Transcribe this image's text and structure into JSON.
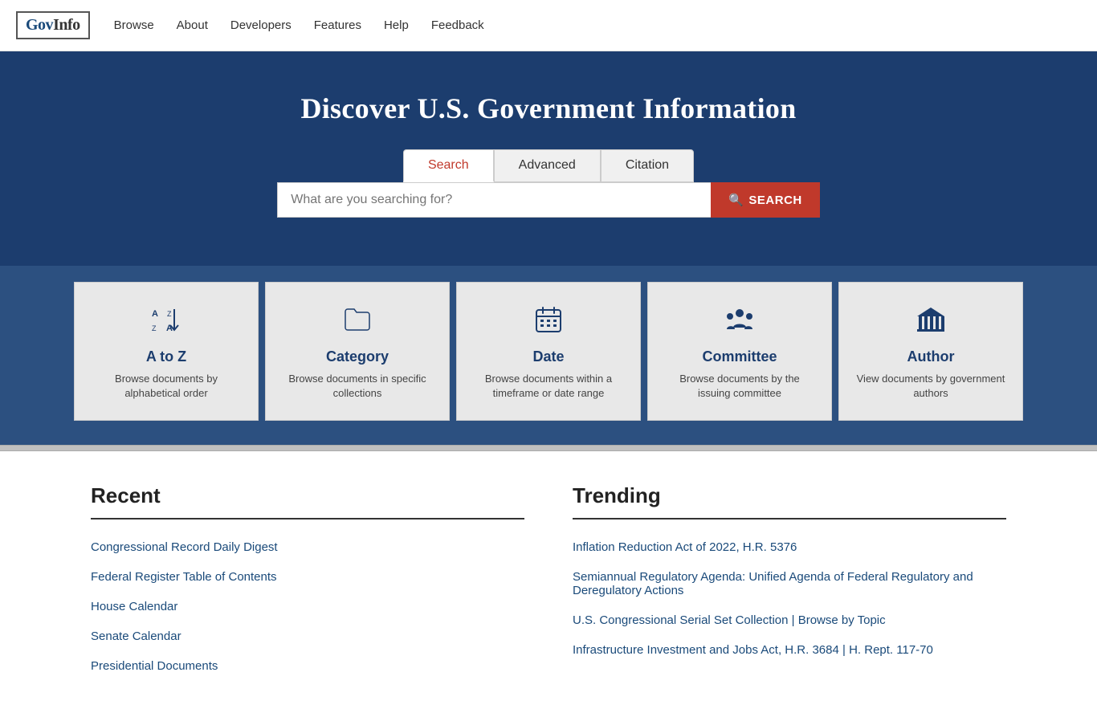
{
  "navbar": {
    "logo_gov": "Gov",
    "logo_info": "Info",
    "links": [
      {
        "label": "Browse",
        "href": "#"
      },
      {
        "label": "About",
        "href": "#"
      },
      {
        "label": "Developers",
        "href": "#"
      },
      {
        "label": "Features",
        "href": "#"
      },
      {
        "label": "Help",
        "href": "#"
      },
      {
        "label": "Feedback",
        "href": "#"
      }
    ]
  },
  "hero": {
    "title": "Discover U.S. Government Information",
    "tabs": [
      {
        "label": "Search",
        "active": true
      },
      {
        "label": "Advanced",
        "active": false
      },
      {
        "label": "Citation",
        "active": false
      }
    ],
    "search_placeholder": "What are you searching for?",
    "search_button": "SEARCH"
  },
  "browse_cards": [
    {
      "icon": "↓A↑Z",
      "icon_name": "a-to-z-icon",
      "title": "A to Z",
      "desc": "Browse documents by alphabetical order"
    },
    {
      "icon": "📂",
      "icon_name": "category-icon",
      "title": "Category",
      "desc": "Browse documents in specific collections"
    },
    {
      "icon": "📅",
      "icon_name": "date-icon",
      "title": "Date",
      "desc": "Browse documents within a timeframe or date range"
    },
    {
      "icon": "👥",
      "icon_name": "committee-icon",
      "title": "Committee",
      "desc": "Browse documents by the issuing committee"
    },
    {
      "icon": "🏛",
      "icon_name": "author-icon",
      "title": "Author",
      "desc": "View documents by government authors"
    }
  ],
  "recent": {
    "title": "Recent",
    "items": [
      "Congressional Record Daily Digest",
      "Federal Register Table of Contents",
      "House Calendar",
      "Senate Calendar",
      "Presidential Documents"
    ]
  },
  "trending": {
    "title": "Trending",
    "items": [
      "Inflation Reduction Act of 2022, H.R. 5376",
      "Semiannual Regulatory Agenda: Unified Agenda of Federal Regulatory and Deregulatory Actions",
      "U.S. Congressional Serial Set Collection | Browse by Topic",
      "Infrastructure Investment and Jobs Act, H.R. 3684 | H. Rept. 117-70"
    ]
  }
}
